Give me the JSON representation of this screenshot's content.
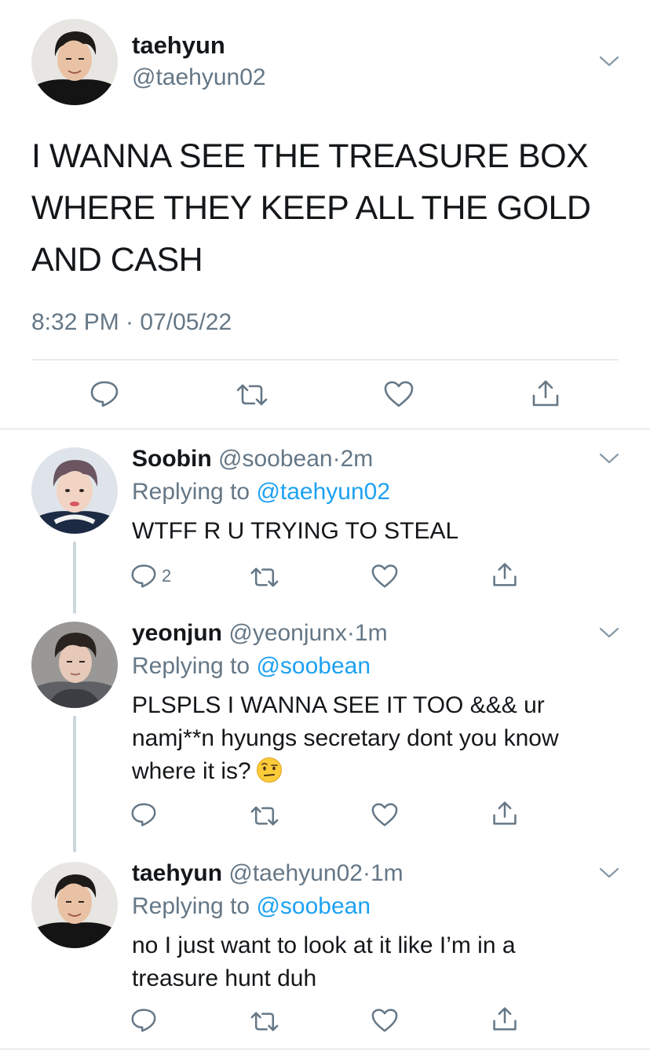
{
  "main_tweet": {
    "name": "taehyun",
    "handle": "@taehyun02",
    "text": "I WANNA SEE THE TREASURE BOX WHERE THEY KEEP ALL THE GOLD AND CASH",
    "timestamp": "8:32 PM · 07/05/22"
  },
  "replies": [
    {
      "name": "Soobin",
      "handle": "@soobean",
      "time": "2m",
      "replying_prefix": "Replying to",
      "replying_to": "@taehyun02",
      "text": "WTFF R U TRYING TO STEAL",
      "reply_count": "2"
    },
    {
      "name": "yeonjun",
      "handle": "@yeonjunx",
      "time": "1m",
      "replying_prefix": "Replying to",
      "replying_to": "@soobean",
      "text": "PLSPLS I WANNA SEE IT TOO &&& ur namj**n hyungs secretary dont you know where it is?",
      "emoji": "face-with-raised-eyebrow-icon"
    },
    {
      "name": "taehyun",
      "handle": "@taehyun02",
      "time": "1m",
      "replying_prefix": "Replying to",
      "replying_to": "@soobean",
      "text": "no I just want to look at it like I’m in a treasure hunt duh"
    }
  ],
  "colors": {
    "text_primary": "#14171a",
    "text_secondary": "#657786",
    "link": "#1da1f2",
    "divider": "#d6dbe0"
  }
}
